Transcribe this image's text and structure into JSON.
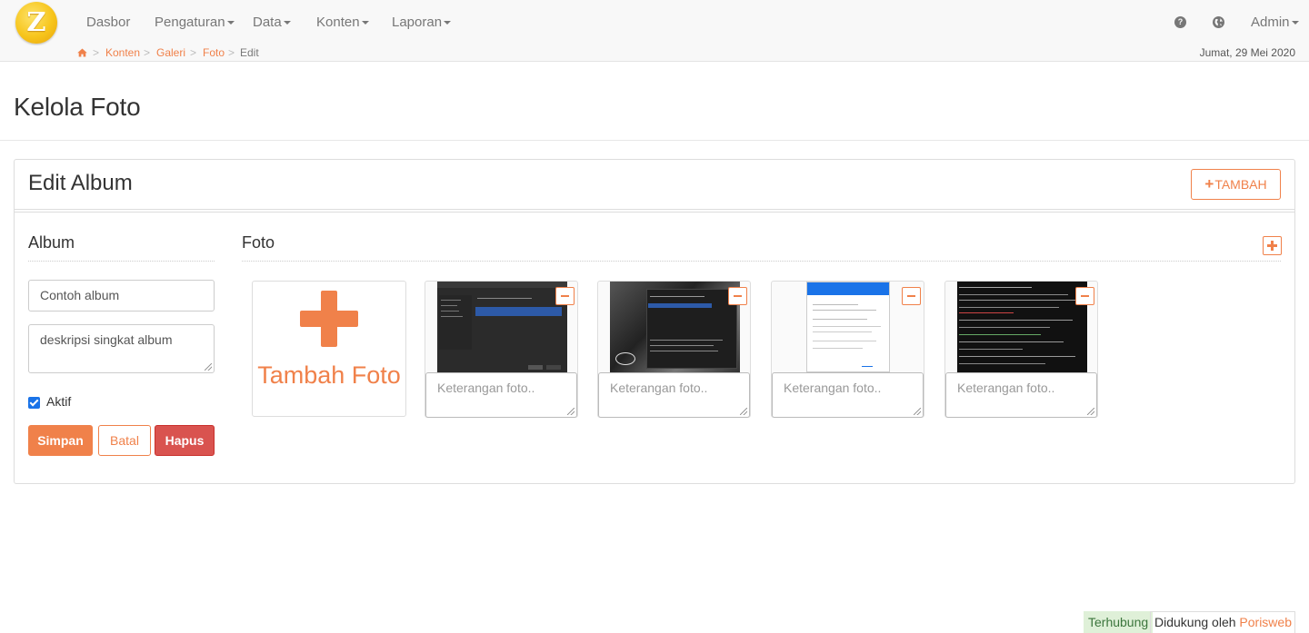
{
  "app": {
    "logo_letter": "Z",
    "accent_color": "#f0814a"
  },
  "nav": {
    "items": [
      {
        "label": "Dasbor",
        "dropdown": false
      },
      {
        "label": "Pengaturan",
        "dropdown": true
      },
      {
        "label": "Data",
        "dropdown": true
      },
      {
        "label": "Konten",
        "dropdown": true
      },
      {
        "label": "Laporan",
        "dropdown": true
      }
    ],
    "help_icon": "question-circle-icon",
    "globe_icon": "globe-icon",
    "user": "Admin"
  },
  "breadcrumb": {
    "home_icon": "home-icon",
    "items": [
      "Konten",
      "Galeri",
      "Foto"
    ],
    "separator": ">",
    "current": "Edit"
  },
  "date": "Jumat, 29 Mei 2020",
  "page": {
    "title": "Kelola Foto"
  },
  "panel": {
    "title": "Edit Album",
    "add_button": "TAMBAH"
  },
  "album": {
    "section_title": "Album",
    "name_value": "Contoh album",
    "description_value": "deskripsi singkat album",
    "active_checked": true,
    "active_label": "Aktif",
    "save_label": "Simpan",
    "cancel_label": "Batal",
    "delete_label": "Hapus"
  },
  "photos": {
    "section_title": "Foto",
    "add_photo_label": "Tambah Foto",
    "caption_placeholder": "Keterangan foto..",
    "items": [
      {
        "thumbnail": "installer-dark-screenshot"
      },
      {
        "thumbnail": "installer-disk-select-screenshot"
      },
      {
        "thumbnail": "email-password-dialog-screenshot"
      },
      {
        "thumbnail": "terminal-output-screenshot"
      }
    ]
  },
  "footer": {
    "status": "Terhubung",
    "powered_prefix": "Didukung oleh",
    "powered_brand": "Porisweb"
  }
}
